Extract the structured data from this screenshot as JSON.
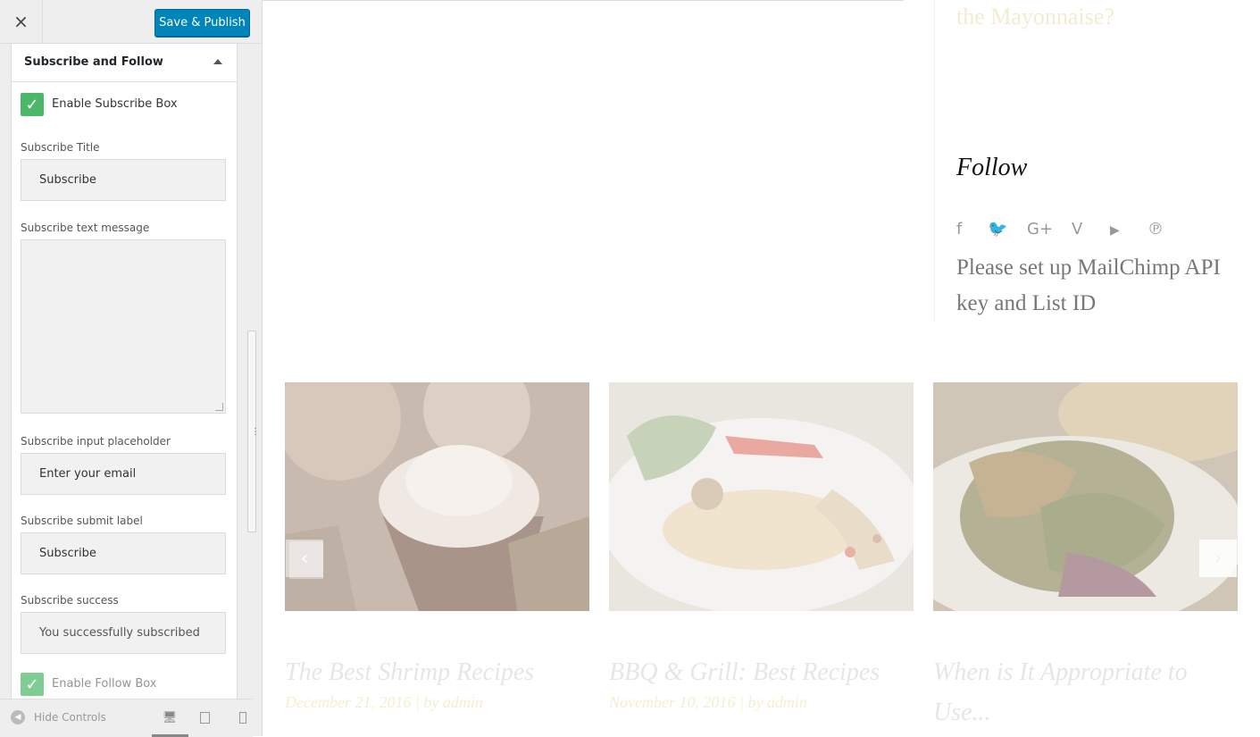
{
  "topbar": {
    "close_label": "×",
    "publish_label": "Save & Publish"
  },
  "section": {
    "title": "Subscribe and Follow"
  },
  "fields": {
    "enable_subscribe_label": "Enable Subscribe Box",
    "enable_subscribe_checked": true,
    "subscribe_title_label": "Subscribe Title",
    "subscribe_title_value": "Subscribe",
    "subscribe_text_label": "Subscribe text message",
    "subscribe_text_value": "",
    "input_placeholder_label": "Subscribe input placeholder",
    "input_placeholder_value": "Enter your email",
    "submit_label_label": "Subscribe submit label",
    "submit_label_value": "Subscribe",
    "success_label": "Subscribe success",
    "success_value": "You successfully subscribed",
    "enable_follow_label": "Enable Follow Box",
    "enable_follow_checked": true
  },
  "footer": {
    "hide_controls_label": "Hide Controls",
    "devices": [
      "desktop-icon",
      "tablet-icon",
      "mobile-icon"
    ]
  },
  "preview": {
    "sidebar_fragment": "the Mayonnaise?",
    "follow_title": "Follow",
    "social_icons": [
      "facebook-icon",
      "twitter-icon",
      "google-plus-icon",
      "vimeo-icon",
      "youtube-icon",
      "pinterest-icon"
    ],
    "mailchimp_message": "Please set up MailChimp API key and List ID",
    "cards": [
      {
        "title": "The Best Shrimp Recipes",
        "date": "December 21, 2016",
        "sep": "|",
        "author": "by admin"
      },
      {
        "title": "BBQ & Grill: Best Recipes",
        "date": "November 10, 2016",
        "sep": "|",
        "author": "by admin"
      },
      {
        "title": "When is It Appropriate to Use...",
        "date": "",
        "sep": "",
        "author": ""
      }
    ]
  },
  "colors": {
    "accent": "#0085ba",
    "checkbox": "#4ab866"
  }
}
